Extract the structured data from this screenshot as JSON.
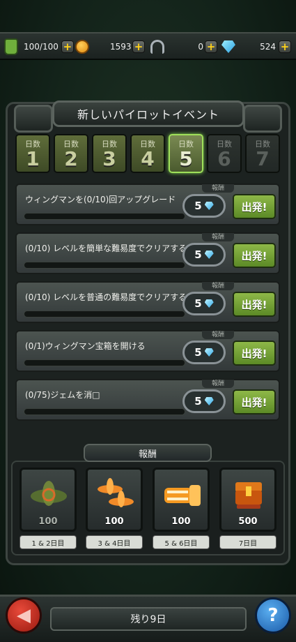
{
  "topbar": {
    "fuel": "100/100",
    "coins": "1593",
    "parts": "0",
    "gems": "524"
  },
  "title": "新しいパイロットイベント",
  "days": [
    {
      "label": "日数",
      "num": "1",
      "state": "done"
    },
    {
      "label": "日数",
      "num": "2",
      "state": "done"
    },
    {
      "label": "日数",
      "num": "3",
      "state": "done"
    },
    {
      "label": "日数",
      "num": "4",
      "state": "done"
    },
    {
      "label": "日数",
      "num": "5",
      "state": "active"
    },
    {
      "label": "日数",
      "num": "6",
      "state": "locked"
    },
    {
      "label": "日数",
      "num": "7",
      "state": "locked"
    }
  ],
  "quests": [
    {
      "text": "ウィングマンを(0/10)回アップグレード",
      "reward_label": "報酬",
      "reward": "5",
      "button": "出発!",
      "progress": 0
    },
    {
      "text": "(0/10) レベルを簡単な難易度でクリアする",
      "reward_label": "報酬",
      "reward": "5",
      "button": "出発!",
      "progress": 0
    },
    {
      "text": "(0/10) レベルを普通の難易度でクリアする",
      "reward_label": "報酬",
      "reward": "5",
      "button": "出発!",
      "progress": 0
    },
    {
      "text": "(0/1)ウィングマン宝箱を開ける",
      "reward_label": "報酬",
      "reward": "5",
      "button": "出発!",
      "progress": 0
    },
    {
      "text": "(0/75)ジェムを消□",
      "reward_label": "報酬",
      "reward": "5",
      "button": "出発!",
      "progress": 0
    }
  ],
  "rewards": {
    "header": "報酬",
    "items": [
      {
        "value": "100",
        "days": "1 & 2日目",
        "icon": "green-plane-icon",
        "claimed": true
      },
      {
        "value": "100",
        "days": "3 & 4日目",
        "icon": "orange-planes-icon",
        "claimed": false
      },
      {
        "value": "100",
        "days": "5 & 6日目",
        "icon": "gatling-gun-icon",
        "claimed": false
      },
      {
        "value": "500",
        "days": "7日目",
        "icon": "treasure-chest-icon",
        "claimed": false
      }
    ]
  },
  "footer": {
    "remaining": "残り9日",
    "back_icon": "back-arrow-icon",
    "help_icon": "question-icon"
  },
  "colors": {
    "accent_green": "#8eb848",
    "active_day": "#9fe05a",
    "gem": "#32a8e8"
  }
}
